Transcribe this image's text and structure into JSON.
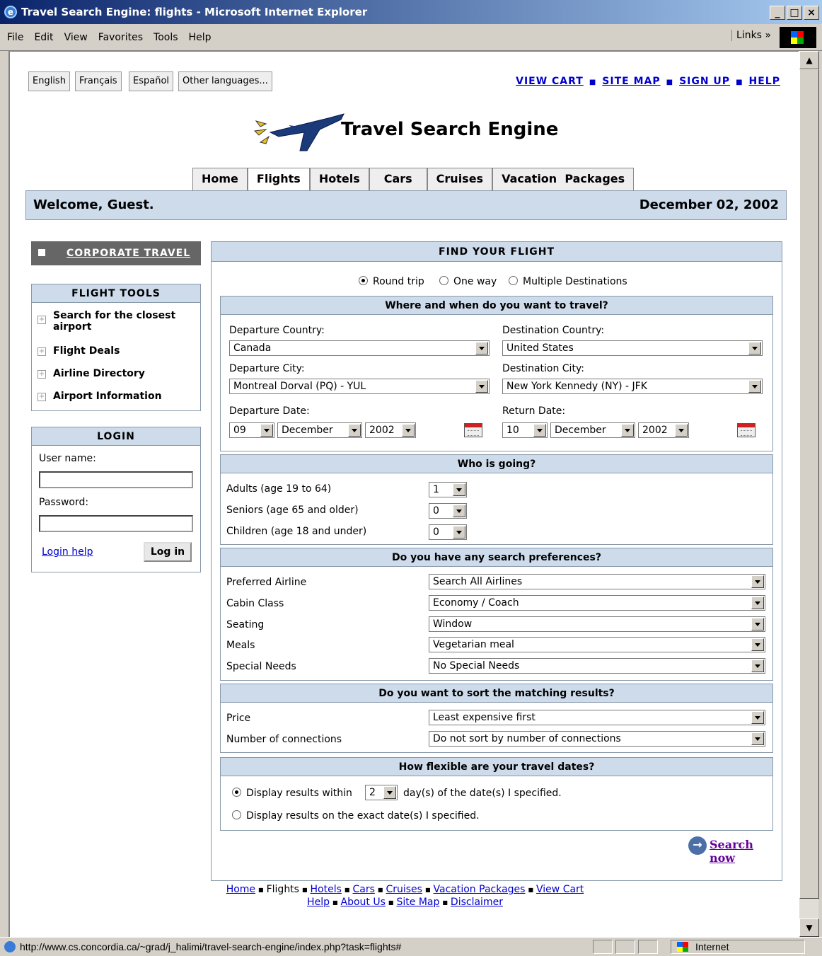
{
  "window": {
    "title": "Travel Search Engine: flights - Microsoft Internet Explorer",
    "controls": [
      "_",
      "□",
      "×"
    ]
  },
  "menu": {
    "items": [
      "File",
      "Edit",
      "View",
      "Favorites",
      "Tools",
      "Help"
    ],
    "links": "Links »"
  },
  "status": {
    "url": "http://www.cs.concordia.ca/~grad/j_halimi/travel-search-engine/index.php?task=flights#",
    "zone": "Internet"
  },
  "languages": [
    "English",
    "Français",
    "Español",
    "Other languages..."
  ],
  "top_links": [
    "VIEW CART",
    "SITE MAP",
    "SIGN UP",
    "HELP"
  ],
  "site_title": "Travel Search Engine",
  "tabs": [
    "Home",
    "Flights",
    "Hotels",
    "Cars",
    "Cruises",
    "Vacation  Packages"
  ],
  "active_tab": "Flights",
  "welcome": {
    "text": "Welcome, Guest.",
    "date": "December 02, 2002"
  },
  "sidebar": {
    "corporate": "CORPORATE TRAVEL",
    "tools_title": "FLIGHT TOOLS",
    "tools": [
      "Search for the closest",
      "airport",
      "Flight Deals",
      "Airline Directory",
      "Airport Information"
    ],
    "login_title": "LOGIN",
    "username_label": "User name:",
    "password_label": "Password:",
    "login_help": "Login help",
    "login_button": "Log in"
  },
  "form": {
    "title": "FIND YOUR FLIGHT",
    "trip_types": [
      "Round trip",
      "One way",
      "Multiple Destinations"
    ],
    "where": {
      "title": "Where and when do you want to travel?",
      "dep_country_label": "Departure Country:",
      "dep_country": "Canada",
      "dest_country_label": "Destination Country:",
      "dest_country": "United States",
      "dep_city_label": "Departure City:",
      "dep_city": "Montreal Dorval (PQ) - YUL",
      "dest_city_label": "Destination City:",
      "dest_city": "New York Kennedy (NY) - JFK",
      "dep_date_label": "Departure Date:",
      "dep_day": "09",
      "dep_month": "December",
      "dep_year": "2002",
      "ret_date_label": "Return Date:",
      "ret_day": "10",
      "ret_month": "December",
      "ret_year": "2002"
    },
    "who": {
      "title": "Who is going?",
      "adults_label": "Adults (age 19 to 64)",
      "adults": "1",
      "seniors_label": "Seniors (age 65 and older)",
      "seniors": "0",
      "children_label": "Children (age 18 and under)",
      "children": "0"
    },
    "prefs": {
      "title": "Do you have any search preferences?",
      "airline_label": "Preferred Airline",
      "airline": "Search All Airlines",
      "cabin_label": "Cabin Class",
      "cabin": "Economy / Coach",
      "seating_label": "Seating",
      "seating": "Window",
      "meals_label": "Meals",
      "meals": "Vegetarian meal",
      "needs_label": "Special Needs",
      "needs": "No Special Needs"
    },
    "sort": {
      "title": "Do you want to sort the matching results?",
      "price_label": "Price",
      "price": "Least expensive first",
      "connections_label": "Number of connections",
      "connections": "Do not sort by number of connections"
    },
    "flex": {
      "title": "How flexible are your travel dates?",
      "within_pre": "Display results within",
      "within_days": "2",
      "within_post": "day(s) of the date(s) I specified.",
      "exact": "Display results on the exact date(s) I specified."
    },
    "search_now": "Search now"
  },
  "footer": {
    "row1": [
      "Home",
      "Flights",
      "Hotels",
      "Cars",
      "Cruises",
      "Vacation Packages",
      "View Cart"
    ],
    "row2": [
      "Help",
      "About Us",
      "Site Map",
      "Disclaimer"
    ]
  }
}
